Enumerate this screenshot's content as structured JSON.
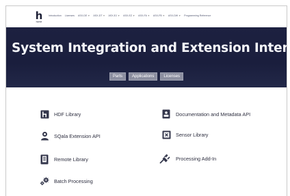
{
  "brand": {
    "mark": "h",
    "name": "home"
  },
  "nav": [
    {
      "label": "Introduction",
      "has_caret": false
    },
    {
      "label": "Licenses",
      "has_caret": false
    },
    {
      "label": "ASX-DE",
      "has_caret": true
    },
    {
      "label": "ASX-DT",
      "has_caret": true
    },
    {
      "label": "ASX-EJ",
      "has_caret": true
    },
    {
      "label": "ASX-EZ",
      "has_caret": true
    },
    {
      "label": "ASX-FA",
      "has_caret": true
    },
    {
      "label": "ASX-FB",
      "has_caret": true
    },
    {
      "label": "ASX-DW",
      "has_caret": true
    },
    {
      "label": "Programming Reference",
      "has_caret": false
    }
  ],
  "hero": {
    "title": "System Integration and Extension Interfaces (ASX)",
    "buttons": [
      "Parts",
      "Applications",
      "Licenses"
    ]
  },
  "features": {
    "hdf_library": {
      "label": "HDF Library",
      "icon": "hdf-library-icon"
    },
    "documentation_api": {
      "label": "Documentation and Metadata API",
      "icon": "document-icon"
    },
    "sqala_api": {
      "label": "SQala Extension API",
      "icon": "person-icon"
    },
    "sensor_library": {
      "label": "Sensor Library",
      "icon": "sensor-icon"
    },
    "remote_library": {
      "label": "Remote Library",
      "icon": "remote-icon"
    },
    "processing_addin": {
      "label": "Processing Add-In",
      "icon": "plug-icon"
    },
    "batch_processing": {
      "label": "Batch Processing",
      "icon": "gears-icon"
    }
  },
  "colors": {
    "hero_bg": "#1d2140",
    "icon": "#34374c",
    "button_bg": "#8c8fa0"
  }
}
